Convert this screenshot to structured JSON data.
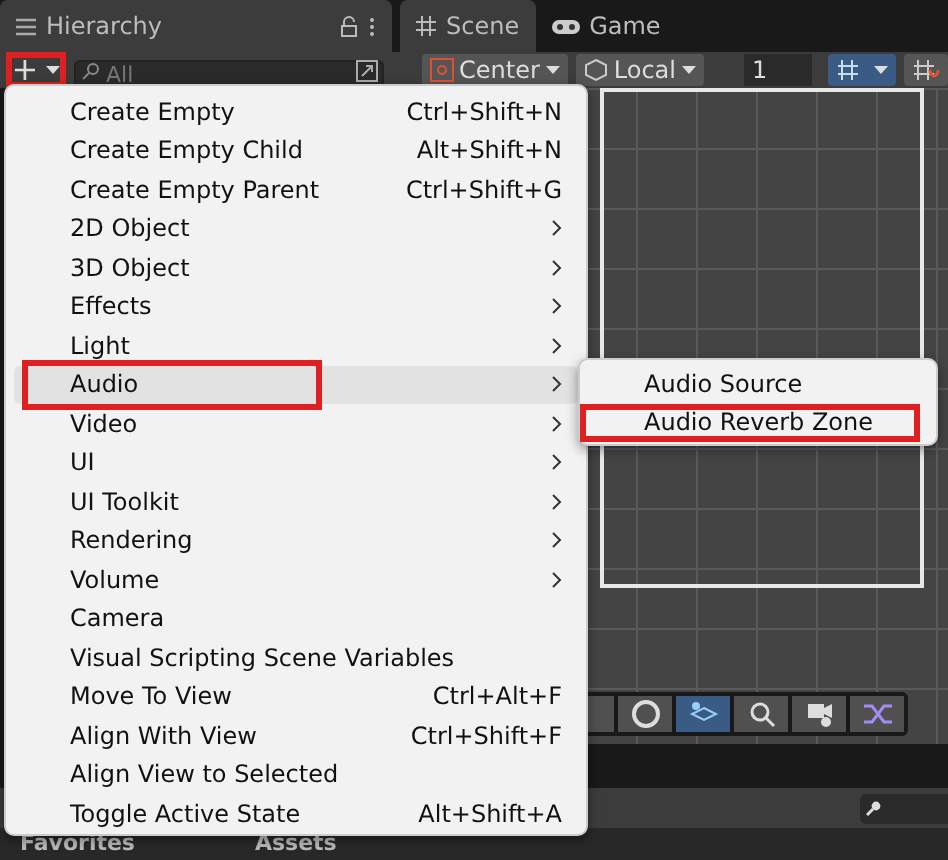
{
  "hierarchy": {
    "title": "Hierarchy",
    "search": {
      "placeholder": "All"
    },
    "add_button": {
      "label": "+",
      "highlighted": true
    }
  },
  "scene_tabs": [
    {
      "label": "Scene",
      "kind": "scene",
      "selected": true
    },
    {
      "label": "Game",
      "kind": "game",
      "selected": false
    }
  ],
  "scene_toolbar": {
    "pivot": "Center",
    "space": "Local",
    "grid_size": "1"
  },
  "menu": [
    {
      "label": "Create Empty",
      "shortcut": "Ctrl+Shift+N",
      "submenu": false,
      "selected": false,
      "highlighted": false
    },
    {
      "label": "Create Empty Child",
      "shortcut": "Alt+Shift+N",
      "submenu": false,
      "selected": false,
      "highlighted": false
    },
    {
      "label": "Create Empty Parent",
      "shortcut": "Ctrl+Shift+G",
      "submenu": false,
      "selected": false,
      "highlighted": false
    },
    {
      "label": "2D Object",
      "submenu": true,
      "selected": false,
      "highlighted": false
    },
    {
      "label": "3D Object",
      "submenu": true,
      "selected": false,
      "highlighted": false
    },
    {
      "label": "Effects",
      "submenu": true,
      "selected": false,
      "highlighted": false
    },
    {
      "label": "Light",
      "submenu": true,
      "selected": false,
      "highlighted": false
    },
    {
      "label": "Audio",
      "submenu": true,
      "selected": true,
      "highlighted": true
    },
    {
      "label": "Video",
      "submenu": true,
      "selected": false,
      "highlighted": false
    },
    {
      "label": "UI",
      "submenu": true,
      "selected": false,
      "highlighted": false
    },
    {
      "label": "UI Toolkit",
      "submenu": true,
      "selected": false,
      "highlighted": false
    },
    {
      "label": "Rendering",
      "submenu": true,
      "selected": false,
      "highlighted": false
    },
    {
      "label": "Volume",
      "submenu": true,
      "selected": false,
      "highlighted": false
    },
    {
      "label": "Camera",
      "submenu": false,
      "selected": false,
      "highlighted": false
    },
    {
      "label": "Visual Scripting Scene Variables",
      "submenu": false,
      "selected": false,
      "highlighted": false
    },
    {
      "label": "Move To View",
      "shortcut": "Ctrl+Alt+F",
      "submenu": false,
      "selected": false,
      "highlighted": false
    },
    {
      "label": "Align With View",
      "shortcut": "Ctrl+Shift+F",
      "submenu": false,
      "selected": false,
      "highlighted": false
    },
    {
      "label": "Align View to Selected",
      "submenu": false,
      "selected": false,
      "highlighted": false
    },
    {
      "label": "Toggle Active State",
      "shortcut": "Alt+Shift+A",
      "submenu": false,
      "selected": false,
      "highlighted": false
    }
  ],
  "submenu": [
    {
      "label": "Audio Source",
      "highlighted": false
    },
    {
      "label": "Audio Reverb Zone",
      "highlighted": true
    }
  ],
  "bottom_tabs": [
    {
      "label": "Favorites"
    },
    {
      "label": "Assets"
    }
  ]
}
